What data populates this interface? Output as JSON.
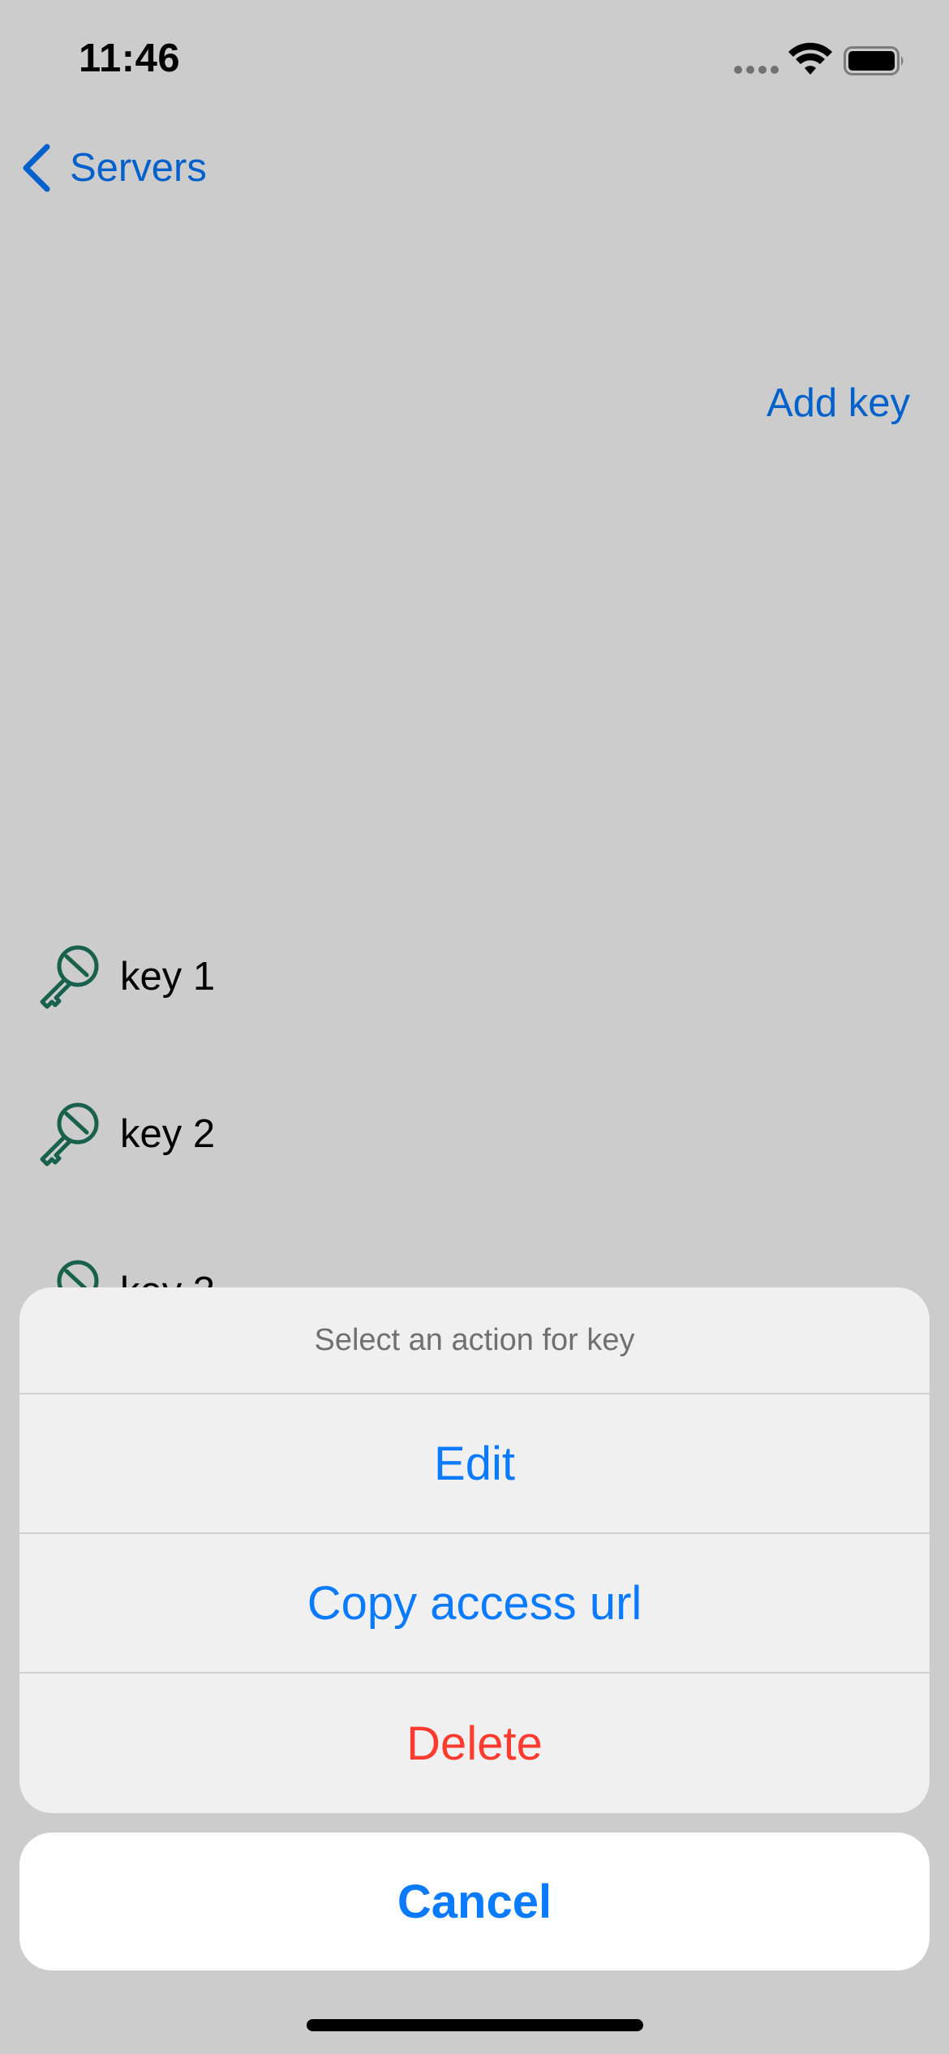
{
  "status_bar": {
    "time": "11:46"
  },
  "nav": {
    "back_label": "Servers",
    "add_key_label": "Add key"
  },
  "keys": [
    {
      "label": "key 1"
    },
    {
      "label": "key 2"
    },
    {
      "label": "key 3"
    }
  ],
  "action_sheet": {
    "title": "Select an action for key",
    "actions": [
      {
        "label": "Edit"
      },
      {
        "label": "Copy access url"
      },
      {
        "label": "Delete"
      }
    ],
    "cancel_label": "Cancel"
  },
  "colors": {
    "accent": "#0a7aff",
    "destructive": "#ff3b30",
    "key_icon": "#1f7a60"
  },
  "icons": {
    "back": "chevron-left-icon",
    "key": "key-icon",
    "wifi": "wifi-icon",
    "battery": "battery-icon",
    "signal": "signal-icon"
  }
}
